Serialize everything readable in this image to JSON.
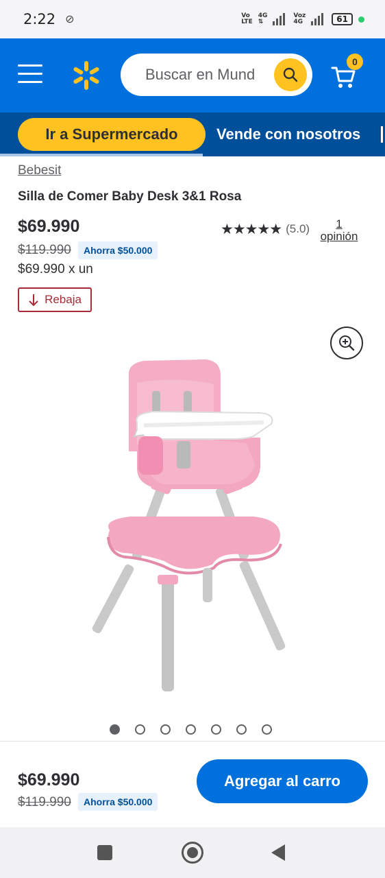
{
  "status_bar": {
    "time": "2:22",
    "net1_top": "Vo",
    "net1_bottom": "LTE",
    "net2_top": "4G",
    "net3_top": "Voz",
    "net3_bottom": "4G",
    "battery": "61"
  },
  "header": {
    "search_placeholder": "Buscar en Mundo Walmart",
    "search_visible": "Buscar en Mund",
    "cart_count": "0",
    "brand_color": "#0071dc",
    "accent_color": "#ffc220"
  },
  "subnav": {
    "primary_label": "Ir a Supermercado",
    "secondary_label": "Vende con nosotros"
  },
  "product": {
    "brand": "Bebesit",
    "title": "Silla de Comer Baby Desk 3&1 Rosa",
    "price": "$69.990",
    "old_price": "$119.990",
    "savings": "Ahorra $50.000",
    "unit_price": "$69.990 x un",
    "stars": "★★★★★",
    "rating": "(5.0)",
    "reviews_count": "1",
    "reviews_label": "opinión",
    "rollback_label": "Rebaja",
    "image_count": 7,
    "active_image": 1
  },
  "bottom_bar": {
    "price": "$69.990",
    "old_price": "$119.990",
    "savings": "Ahorra $50.000",
    "add_to_cart": "Agregar al carro"
  }
}
